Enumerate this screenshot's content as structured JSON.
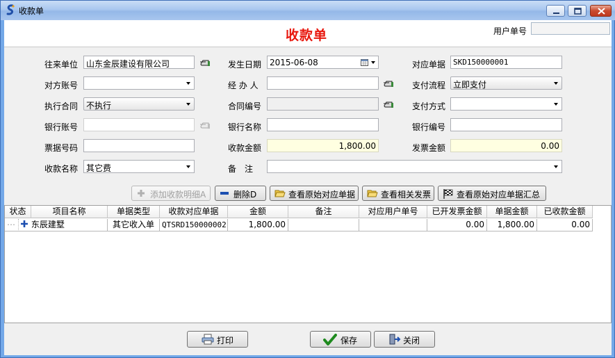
{
  "window": {
    "title": "收款单"
  },
  "header": {
    "form_title": "收款单",
    "user_no_label": "用户单号",
    "user_no_value": ""
  },
  "form": {
    "partner_label": "往来单位",
    "partner_value": "山东金辰建设有限公司",
    "date_label": "发生日期",
    "date_value": "2015-06-08",
    "ref_doc_label": "对应单据",
    "ref_doc_value": "SKD150000001",
    "account_label": "对方账号",
    "account_value": "",
    "handler_label": "经 办 人",
    "handler_value": "",
    "pay_flow_label": "支付流程",
    "pay_flow_value": "立即支付",
    "contract_label": "执行合同",
    "contract_value": "不执行",
    "contract_no_label": "合同编号",
    "contract_no_value": "",
    "pay_method_label": "支付方式",
    "pay_method_value": "",
    "bank_account_label": "银行账号",
    "bank_account_value": "",
    "bank_name_label": "银行名称",
    "bank_name_value": "",
    "bank_code_label": "银行编号",
    "bank_code_value": "",
    "ticket_no_label": "票据号码",
    "ticket_no_value": "",
    "amount_label": "收款金额",
    "amount_value": "1,800.00",
    "invoice_amount_label": "发票金额",
    "invoice_amount_value": "0.00",
    "receipt_name_label": "收款名称",
    "receipt_name_value": "其它费",
    "remark_label": "备　注",
    "remark_value": ""
  },
  "toolbar": {
    "add_detail": "添加收款明细A",
    "delete": "删除D",
    "view_origin": "查看原始对应单据",
    "view_invoice": "查看相关发票",
    "view_summary": "查看原始对应单据汇总"
  },
  "grid": {
    "columns": [
      "状态",
      "项目名称",
      "单据类型",
      "收款对应单据",
      "金额",
      "备注",
      "对应用户单号",
      "已开发票金额",
      "单据金额",
      "已收款金额"
    ],
    "rows": [
      {
        "status": "",
        "project": "东辰建墅",
        "doc_type": "其它收入单",
        "ref_doc": "QTSRD150000002",
        "amount": "1,800.00",
        "remark": "",
        "user_no": "",
        "invoiced": "0.00",
        "doc_amount": "1,800.00",
        "received": "0.00"
      }
    ]
  },
  "footer": {
    "print": "打印",
    "save": "保存",
    "close": "关闭"
  },
  "colors": {
    "title_red": "#e8160c",
    "money_bg": "#ffffe1",
    "window_blue": "#73a8e8"
  },
  "icons": {
    "app": "app-logo-icon",
    "pick": "hand-pointer-icon",
    "calendar": "calendar-icon",
    "add": "plus-icon",
    "delete": "minus-icon",
    "folder": "folder-open-icon",
    "flag": "checkered-flag-icon",
    "print": "printer-icon",
    "save": "checkmark-icon",
    "close": "exit-door-icon"
  }
}
